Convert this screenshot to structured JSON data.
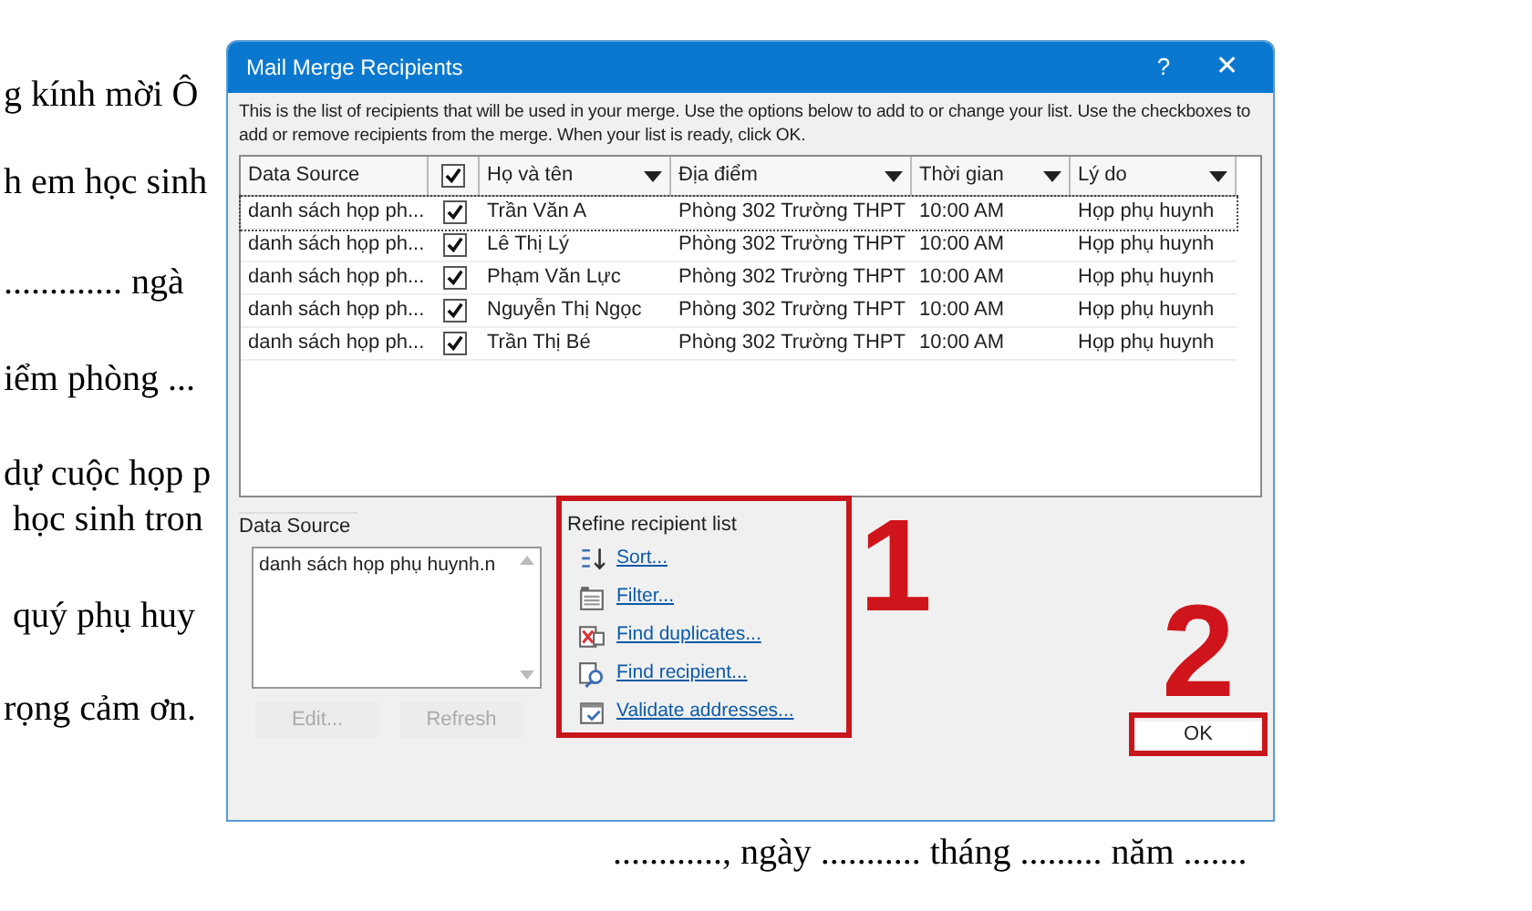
{
  "document": {
    "lines": [
      "g kính mời Ô",
      "h em học sinh",
      "............. ngà",
      "iểm phòng ...",
      "dự cuộc họp p",
      " học sinh tron",
      " quý phụ huy",
      "rọng cảm ơn."
    ],
    "footer": "............, ngày ........... tháng ......... năm ......."
  },
  "dialog": {
    "title": "Mail Merge Recipients",
    "help": "?",
    "close": "✕",
    "intro": "This is the list of recipients that will be used in your merge.  Use the options below to add to or change your list. Use the checkboxes to add or remove recipients from the merge.  When your list is ready, click OK.",
    "table": {
      "columns": [
        {
          "kind": "text",
          "label": "Data Source",
          "dropdown": false
        },
        {
          "kind": "checkbox",
          "checked": true
        },
        {
          "kind": "text",
          "label": "Họ và tên",
          "dropdown": true
        },
        {
          "kind": "text",
          "label": "Địa điểm",
          "dropdown": true
        },
        {
          "kind": "text",
          "label": "Thời gian",
          "dropdown": true
        },
        {
          "kind": "text",
          "label": "Lý do",
          "dropdown": true
        }
      ],
      "rows": [
        {
          "focused": true,
          "source": "danh sách họp ph...",
          "checked": true,
          "name": "Trần Văn A",
          "place": "Phòng 302 Trường THPT",
          "time": "10:00 AM",
          "reason": "Họp phụ huynh"
        },
        {
          "focused": false,
          "source": "danh sách họp ph...",
          "checked": true,
          "name": "Lê Thị Lý",
          "place": "Phòng 302 Trường THPT",
          "time": "10:00 AM",
          "reason": "Họp phụ huynh"
        },
        {
          "focused": false,
          "source": "danh sách họp ph...",
          "checked": true,
          "name": "Phạm Văn Lực",
          "place": "Phòng 302 Trường THPT",
          "time": "10:00 AM",
          "reason": "Họp phụ huynh"
        },
        {
          "focused": false,
          "source": "danh sách họp ph...",
          "checked": true,
          "name": "Nguyễn Thị Ngọc",
          "place": "Phòng 302 Trường THPT",
          "time": "10:00 AM",
          "reason": "Họp phụ huynh"
        },
        {
          "focused": false,
          "source": "danh sách họp ph...",
          "checked": true,
          "name": "Trần Thị Bé",
          "place": "Phòng 302 Trường THPT",
          "time": "10:00 AM",
          "reason": "Họp phụ huynh"
        }
      ]
    },
    "data_source": {
      "label": "Data Source",
      "items": [
        "danh sách họp phụ huynh.n"
      ],
      "buttons": [
        {
          "label": "Edit...",
          "disabled": true
        },
        {
          "label": "Refresh",
          "disabled": true
        }
      ]
    },
    "refine": {
      "label": "Refine recipient list",
      "links": [
        {
          "kind": "sort",
          "label": "Sort..."
        },
        {
          "kind": "filter",
          "label": "Filter..."
        },
        {
          "kind": "duplicates",
          "label": "Find duplicates..."
        },
        {
          "kind": "find",
          "label": "Find recipient..."
        },
        {
          "kind": "validate",
          "label": "Validate addresses..."
        }
      ]
    },
    "ok": "OK"
  },
  "annotations": [
    {
      "label": "1"
    },
    {
      "label": "2"
    }
  ]
}
